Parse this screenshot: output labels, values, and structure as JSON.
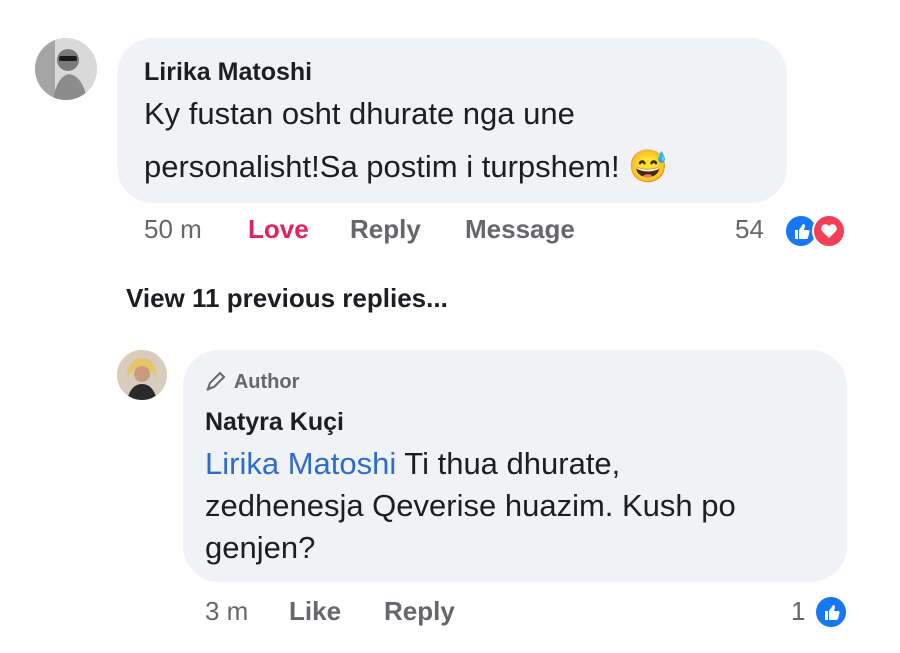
{
  "comment": {
    "author": "Lirika Matoshi",
    "text_line1": "Ky fustan osht dhurate nga une",
    "text_line2": "personalisht!Sa postim i turpshem!",
    "emoji": "😅",
    "time": "50 m",
    "love_label": "Love",
    "reply_label": "Reply",
    "message_label": "Message",
    "reaction_count": "54"
  },
  "view_previous": "View 11 previous replies...",
  "reply": {
    "badge": "Author",
    "author": "Natyra Kuçi",
    "mention": "Lirika Matoshi",
    "text_line1_rest": " Ti thua dhurate,",
    "text_line2": "zedhenesja Qeverise huazim. Kush po",
    "text_line3": "genjen?",
    "time": "3 m",
    "like_label": "Like",
    "reply_label": "Reply",
    "reaction_count": "1"
  },
  "colors": {
    "bubble": "#f0f2f5",
    "mention": "#2e6cc9",
    "love": "#e0245e",
    "like_reaction": "#1877f2",
    "love_reaction": "#f33e58"
  }
}
